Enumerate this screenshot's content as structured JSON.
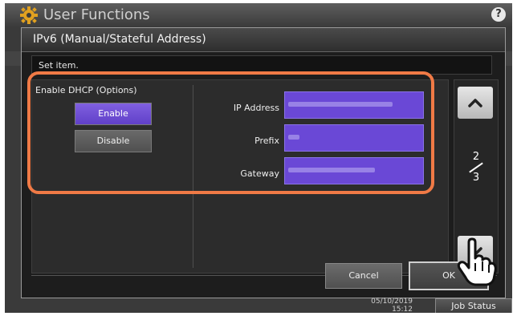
{
  "app": {
    "title": "User Functions",
    "help_icon": "?"
  },
  "dialog": {
    "title": "IPv6 (Manual/Stateful Address)",
    "instruction": "Set item."
  },
  "dhcp": {
    "label": "Enable DHCP (Options)",
    "enable_label": "Enable",
    "disable_label": "Disable",
    "selected": "Enable"
  },
  "fields": [
    {
      "label": "IP Address",
      "value": ""
    },
    {
      "label": "Prefix",
      "value": ""
    },
    {
      "label": "Gateway",
      "value": ""
    }
  ],
  "pagination": {
    "current": "2",
    "total": "3"
  },
  "buttons": {
    "cancel": "Cancel",
    "ok": "OK"
  },
  "status": {
    "date": "05/10/2019",
    "time": "15:12",
    "job_status": "Job Status"
  },
  "colors": {
    "accent": "#6a48d6",
    "highlight": "#f07a46"
  },
  "icons": [
    "gear-icon",
    "help-icon",
    "chevron-up-icon",
    "chevron-down-icon",
    "hand-pointer-icon"
  ]
}
